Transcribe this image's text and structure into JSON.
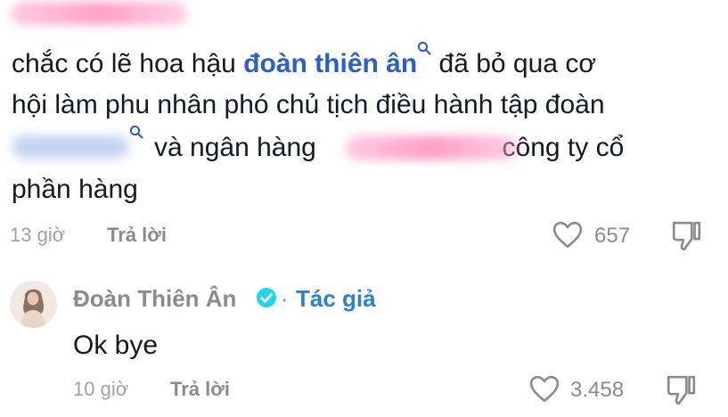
{
  "comment_1": {
    "line1_part1": "chắc có lẽ hoa hậu ",
    "mention": "đoàn thiên ân",
    "line1_part2": " đã bỏ qua cơ",
    "line2": "hội làm phu nhân phó chủ tịch điều hành tập đoàn",
    "line3_part1": "và ngân hàng ",
    "line3_part2": " công ty cổ",
    "line4": "phần hàng",
    "time": "13 giờ",
    "reply_label": "Trả lời",
    "likes": "657"
  },
  "reply_1": {
    "author": "Đoàn Thiên Ân",
    "separator": "·",
    "author_tag": "Tác giả",
    "text": "Ok bye",
    "time": "10 giờ",
    "reply_label": "Trả lời",
    "likes": "3.458"
  },
  "colors": {
    "mention_blue": "#2b5fc7",
    "verified_blue": "#20d5ec",
    "meta_gray": "#a1a2a7"
  },
  "icons": {
    "like": "heart-outline-icon",
    "dislike": "thumbs-down-icon",
    "search": "search-icon",
    "verified": "verified-badge-icon"
  }
}
